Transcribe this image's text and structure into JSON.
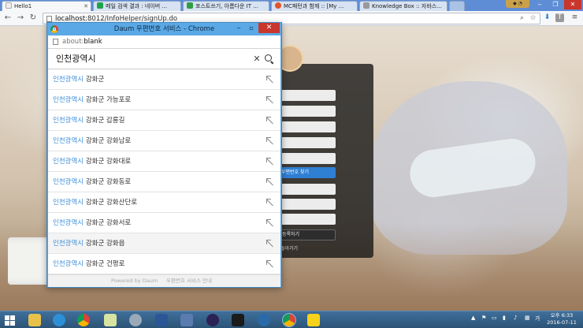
{
  "browser": {
    "tabs": [
      {
        "label": "Hello1",
        "active": true,
        "icon_color": "#f4f4f4"
      },
      {
        "label": "메일 검색 결과 : 네이버 ...",
        "active": false,
        "icon_color": "#1fa34a"
      },
      {
        "label": "포스트쓰기, 아름다운 IT ...",
        "active": false,
        "icon_color": "#2f9e44"
      },
      {
        "label": "MC패턴과 함께 :: [My ...",
        "active": false,
        "icon_color": "#e0552a"
      },
      {
        "label": "Knowledge Box :: 자바스...",
        "active": false,
        "icon_color": "#888888"
      }
    ],
    "url_host": "localhost",
    "url_rest": ":8012/InfoHelper/signUp.do",
    "window_controls": [
      "‒",
      "❐",
      "✕"
    ]
  },
  "popup": {
    "title": "Daum 우편번호 서비스 - Chrome",
    "url_prefix": "about:",
    "url_bold": "blank",
    "search_value": "인천광역시",
    "results": [
      {
        "city": "인천광역시",
        "rest": "강화군"
      },
      {
        "city": "인천광역시",
        "rest": "강화군 가능포로"
      },
      {
        "city": "인천광역시",
        "rest": "강화군 갑룡길"
      },
      {
        "city": "인천광역시",
        "rest": "강화군 강화남로"
      },
      {
        "city": "인천광역시",
        "rest": "강화군 강화대로"
      },
      {
        "city": "인천광역시",
        "rest": "강화군 강화동로"
      },
      {
        "city": "인천광역시",
        "rest": "강화군 강화산단로"
      },
      {
        "city": "인천광역시",
        "rest": "강화군 강화서로"
      },
      {
        "city": "인천광역시",
        "rest": "강화군 강화읍"
      },
      {
        "city": "인천광역시",
        "rest": "강화군 건평로"
      }
    ],
    "footer_powered": "Powered by Daum",
    "footer_notice": "우편번호 서비스 안내"
  },
  "page": {
    "find_address_button": "우편번호 찾기",
    "signup_button": "등록하기",
    "back_link": "돌아가기"
  },
  "taskbar": {
    "ime": "가",
    "clock_period": "오후 6:33",
    "clock_date": "2016-07-11"
  },
  "colors": {
    "accent_link": "#3f8fd8",
    "popup_frame": "#5aa9e6",
    "close_red": "#c9362b",
    "taskbar": "#2c5477"
  }
}
